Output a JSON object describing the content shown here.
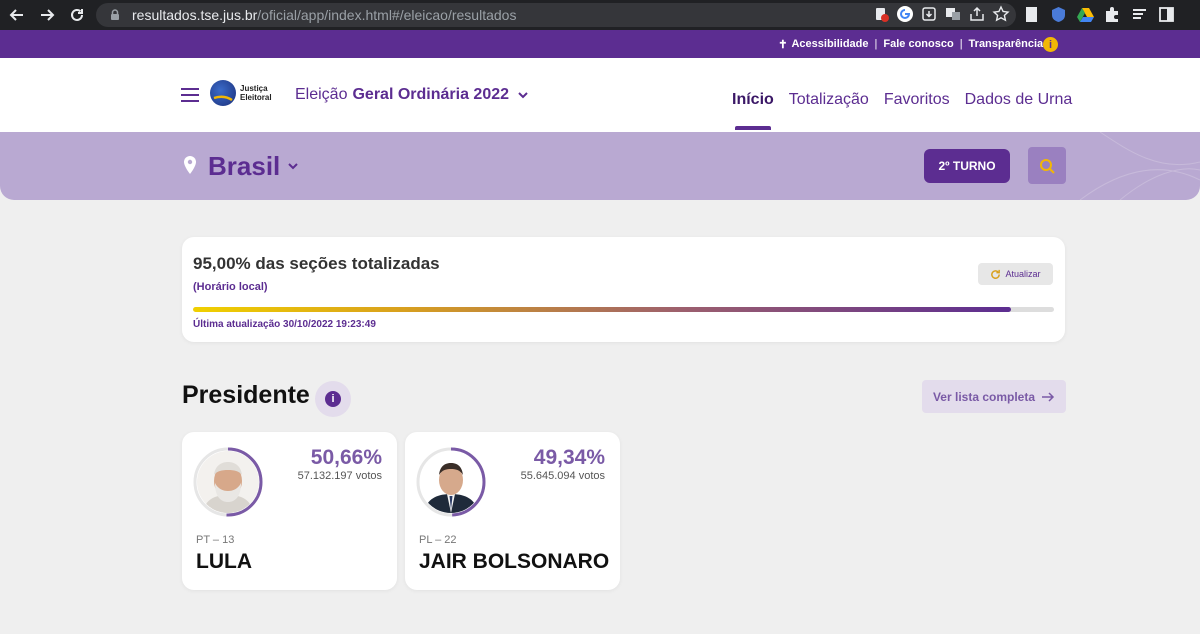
{
  "browser": {
    "url_host": "resultados.tse.jus.br",
    "url_path": "/oficial/app/index.html#/eleicao/resultados"
  },
  "top_links": {
    "accessibility": "Acessibilidade",
    "contact": "Fale conosco",
    "transparency": "Transparência",
    "info_glyph": "i"
  },
  "header": {
    "logo_line1": "Justiça",
    "logo_line2": "Eleitoral",
    "election_prefix": "Eleição",
    "election_name": "Geral Ordinária 2022",
    "nav": [
      "Início",
      "Totalização",
      "Favoritos",
      "Dados de Urna"
    ]
  },
  "location": {
    "name": "Brasil",
    "turno_label": "2º TURNO"
  },
  "progress": {
    "title": "95,00% das seções totalizadas",
    "local_time_label": "(Horário local)",
    "refresh_label": "Atualizar",
    "fraction": 0.95,
    "last_update": "Última atualização 30/10/2022 19:23:49"
  },
  "section": {
    "title": "Presidente",
    "info_glyph": "i",
    "full_list_label": "Ver lista completa"
  },
  "candidates": [
    {
      "percent": "50,66%",
      "votes": "57.132.197 votos",
      "party": "PT – 13",
      "name": "LULA",
      "share": 0.5066
    },
    {
      "percent": "49,34%",
      "votes": "55.645.094 votos",
      "party": "PL – 22",
      "name": "JAIR BOLSONARO",
      "share": 0.4934
    }
  ],
  "colors": {
    "brand_purple": "#5c2d91",
    "band_lilac": "#b9a9d2",
    "accent_yellow": "#f2b705"
  }
}
